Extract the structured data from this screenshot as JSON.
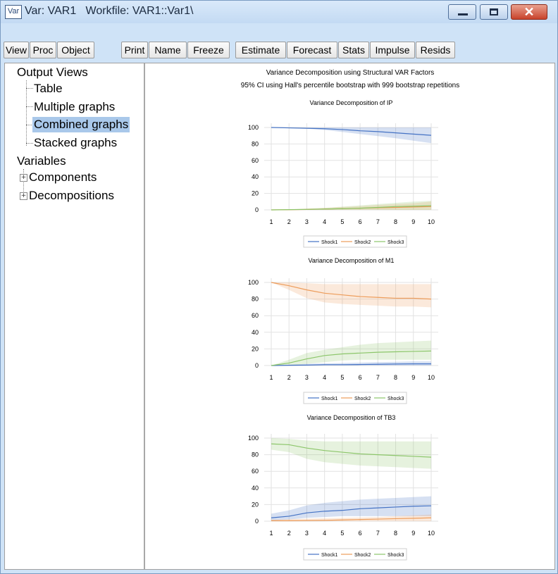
{
  "window": {
    "app_icon_text": "Var",
    "title": "Var: VAR1   Workfile: VAR1::Var1\\",
    "close_glyph": "✕"
  },
  "toolbar": {
    "buttons": [
      "View",
      "Proc",
      "Object",
      "Print",
      "Name",
      "Freeze",
      "Estimate",
      "Forecast",
      "Stats",
      "Impulse",
      "Resids"
    ]
  },
  "tree": {
    "output_views": "Output Views",
    "table": "Table",
    "multiple_graphs": "Multiple graphs",
    "combined_graphs": "Combined graphs",
    "stacked_graphs": "Stacked graphs",
    "variables": "Variables",
    "components": "Components",
    "decompositions": "Decompositions",
    "expander_glyph": "+"
  },
  "graph_header": {
    "line1": "Variance Decomposition using Structural VAR Factors",
    "line2": "95% CI using Hall's percentile bootstrap with 999 bootstrap repetitions"
  },
  "colors": {
    "shock1": "#4472c4",
    "shock2": "#ed9c5a",
    "shock3": "#8cc66a"
  },
  "chart_data": [
    {
      "type": "line",
      "title": "Variance Decomposition of IP",
      "x": [
        1,
        2,
        3,
        4,
        5,
        6,
        7,
        8,
        9,
        10
      ],
      "ylim": [
        0,
        100
      ],
      "yticks": [
        0,
        20,
        40,
        60,
        80,
        100
      ],
      "grid": true,
      "legend_position": "bottom",
      "series": [
        {
          "name": "Shock1",
          "values": [
            100,
            99.5,
            99,
            98.5,
            97.5,
            96,
            95,
            93.5,
            92,
            90.5
          ],
          "lower": [
            100,
            99,
            98.5,
            97,
            94.5,
            92,
            89.5,
            87,
            84,
            81
          ],
          "upper": [
            100,
            100,
            100,
            100,
            100,
            100,
            100,
            100,
            100,
            100
          ]
        },
        {
          "name": "Shock2",
          "values": [
            0,
            0.2,
            0.5,
            1,
            1.5,
            2,
            2.5,
            3,
            3.5,
            4
          ],
          "lower": [
            0,
            0,
            0,
            0,
            0,
            0,
            0,
            0,
            0,
            0
          ],
          "upper": [
            0,
            0.5,
            1.5,
            2.5,
            3.5,
            4.5,
            6,
            7,
            8,
            10
          ]
        },
        {
          "name": "Shock3",
          "values": [
            0,
            0.3,
            0.6,
            1,
            1.5,
            2,
            3,
            4,
            4.5,
            5
          ],
          "lower": [
            0,
            0,
            0,
            0,
            0,
            0,
            0,
            0,
            0,
            0
          ],
          "upper": [
            0,
            0.5,
            1.5,
            2.5,
            4,
            5.5,
            7,
            8.5,
            10,
            11
          ]
        }
      ]
    },
    {
      "type": "line",
      "title": "Variance Decomposition of M1",
      "x": [
        1,
        2,
        3,
        4,
        5,
        6,
        7,
        8,
        9,
        10
      ],
      "ylim": [
        0,
        100
      ],
      "yticks": [
        0,
        20,
        40,
        60,
        80,
        100
      ],
      "grid": true,
      "legend_position": "bottom",
      "series": [
        {
          "name": "Shock1",
          "values": [
            0,
            0.3,
            0.5,
            1,
            1,
            1.2,
            1.5,
            1.8,
            2,
            2
          ],
          "lower": [
            0,
            0,
            0,
            0,
            0,
            0,
            0,
            0,
            0,
            0
          ],
          "upper": [
            0,
            1,
            2,
            2.5,
            3,
            3.5,
            4,
            4.5,
            5,
            5
          ]
        },
        {
          "name": "Shock2",
          "values": [
            100,
            96,
            91,
            87,
            85,
            83,
            82,
            81,
            81,
            80
          ],
          "lower": [
            100,
            91,
            81,
            76,
            74,
            73,
            72,
            71,
            71,
            70
          ],
          "upper": [
            100,
            100,
            99,
            98,
            98,
            98,
            98,
            98,
            98,
            98
          ]
        },
        {
          "name": "Shock3",
          "values": [
            0,
            3,
            8,
            12,
            14,
            15,
            16,
            16.5,
            17,
            17.5
          ],
          "lower": [
            0,
            0,
            2,
            4,
            6,
            7,
            7,
            7,
            7,
            7
          ],
          "upper": [
            0,
            7,
            15,
            19,
            22,
            25,
            27,
            28,
            29,
            30
          ]
        }
      ]
    },
    {
      "type": "line",
      "title": "Variance Decomposition of TB3",
      "x": [
        1,
        2,
        3,
        4,
        5,
        6,
        7,
        8,
        9,
        10
      ],
      "ylim": [
        0,
        100
      ],
      "yticks": [
        0,
        20,
        40,
        60,
        80,
        100
      ],
      "grid": true,
      "legend_position": "bottom",
      "series": [
        {
          "name": "Shock1",
          "values": [
            4,
            6,
            10,
            12,
            13,
            15,
            16,
            17,
            18,
            18.5
          ],
          "lower": [
            1,
            2,
            4,
            5,
            6,
            6,
            6,
            6,
            6,
            6
          ],
          "upper": [
            9,
            13,
            19,
            22,
            24,
            26,
            27,
            28,
            29,
            30
          ]
        },
        {
          "name": "Shock2",
          "values": [
            0.5,
            0.5,
            0.8,
            1,
            1.5,
            2,
            2.5,
            3,
            3.5,
            4
          ],
          "lower": [
            0,
            0,
            0,
            0,
            0,
            0,
            0,
            0,
            0,
            0
          ],
          "upper": [
            2,
            2.5,
            3,
            3.5,
            4,
            4.5,
            5,
            6,
            7,
            8
          ]
        },
        {
          "name": "Shock3",
          "values": [
            93,
            92,
            88,
            85,
            83,
            81,
            80,
            79,
            78,
            77
          ],
          "lower": [
            86,
            83,
            75,
            71,
            69,
            67,
            66,
            65,
            64,
            63
          ],
          "upper": [
            100,
            99,
            97,
            96,
            96,
            96,
            96,
            96,
            96,
            96
          ]
        }
      ]
    }
  ]
}
